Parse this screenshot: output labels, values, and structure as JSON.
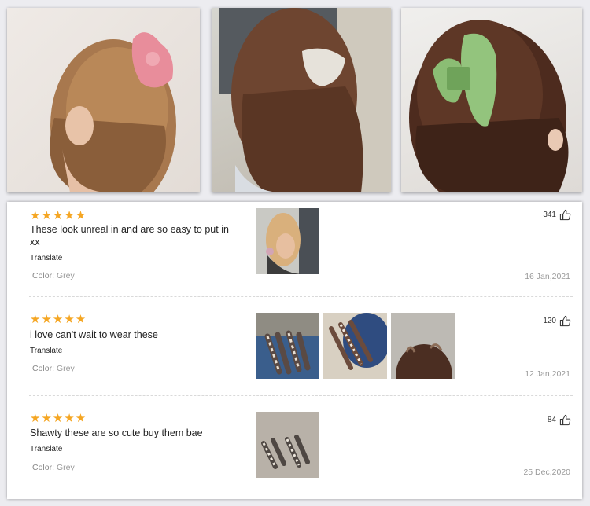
{
  "hero_photos": [
    {
      "icon": "pink-hair-claw-photo",
      "accent": "#e88d9b"
    },
    {
      "icon": "grey-hair-claw-photo",
      "accent": "#e6e2da"
    },
    {
      "icon": "green-hair-claw-photo",
      "accent": "#8bbd74"
    }
  ],
  "reviews": [
    {
      "stars": "★★★★★",
      "text": "These look unreal in and are so easy to put in xx",
      "translate": "Translate",
      "color_label": "Color:",
      "color_value": "Grey",
      "likes": "341",
      "date": "16 Jan,2021"
    },
    {
      "stars": "★★★★★",
      "text": "i love can't wait to wear these",
      "translate": "Translate",
      "color_label": "Color:",
      "color_value": "Grey",
      "likes": "120",
      "date": "12 Jan,2021"
    },
    {
      "stars": "★★★★★",
      "text": "Shawty these are so cute buy them bae",
      "translate": "Translate",
      "color_label": "Color:",
      "color_value": "Grey",
      "likes": "84",
      "date": "25 Dec,2020"
    }
  ],
  "colors": {
    "star": "#f5a623",
    "muted_text": "#999999",
    "body_text": "#222222"
  }
}
